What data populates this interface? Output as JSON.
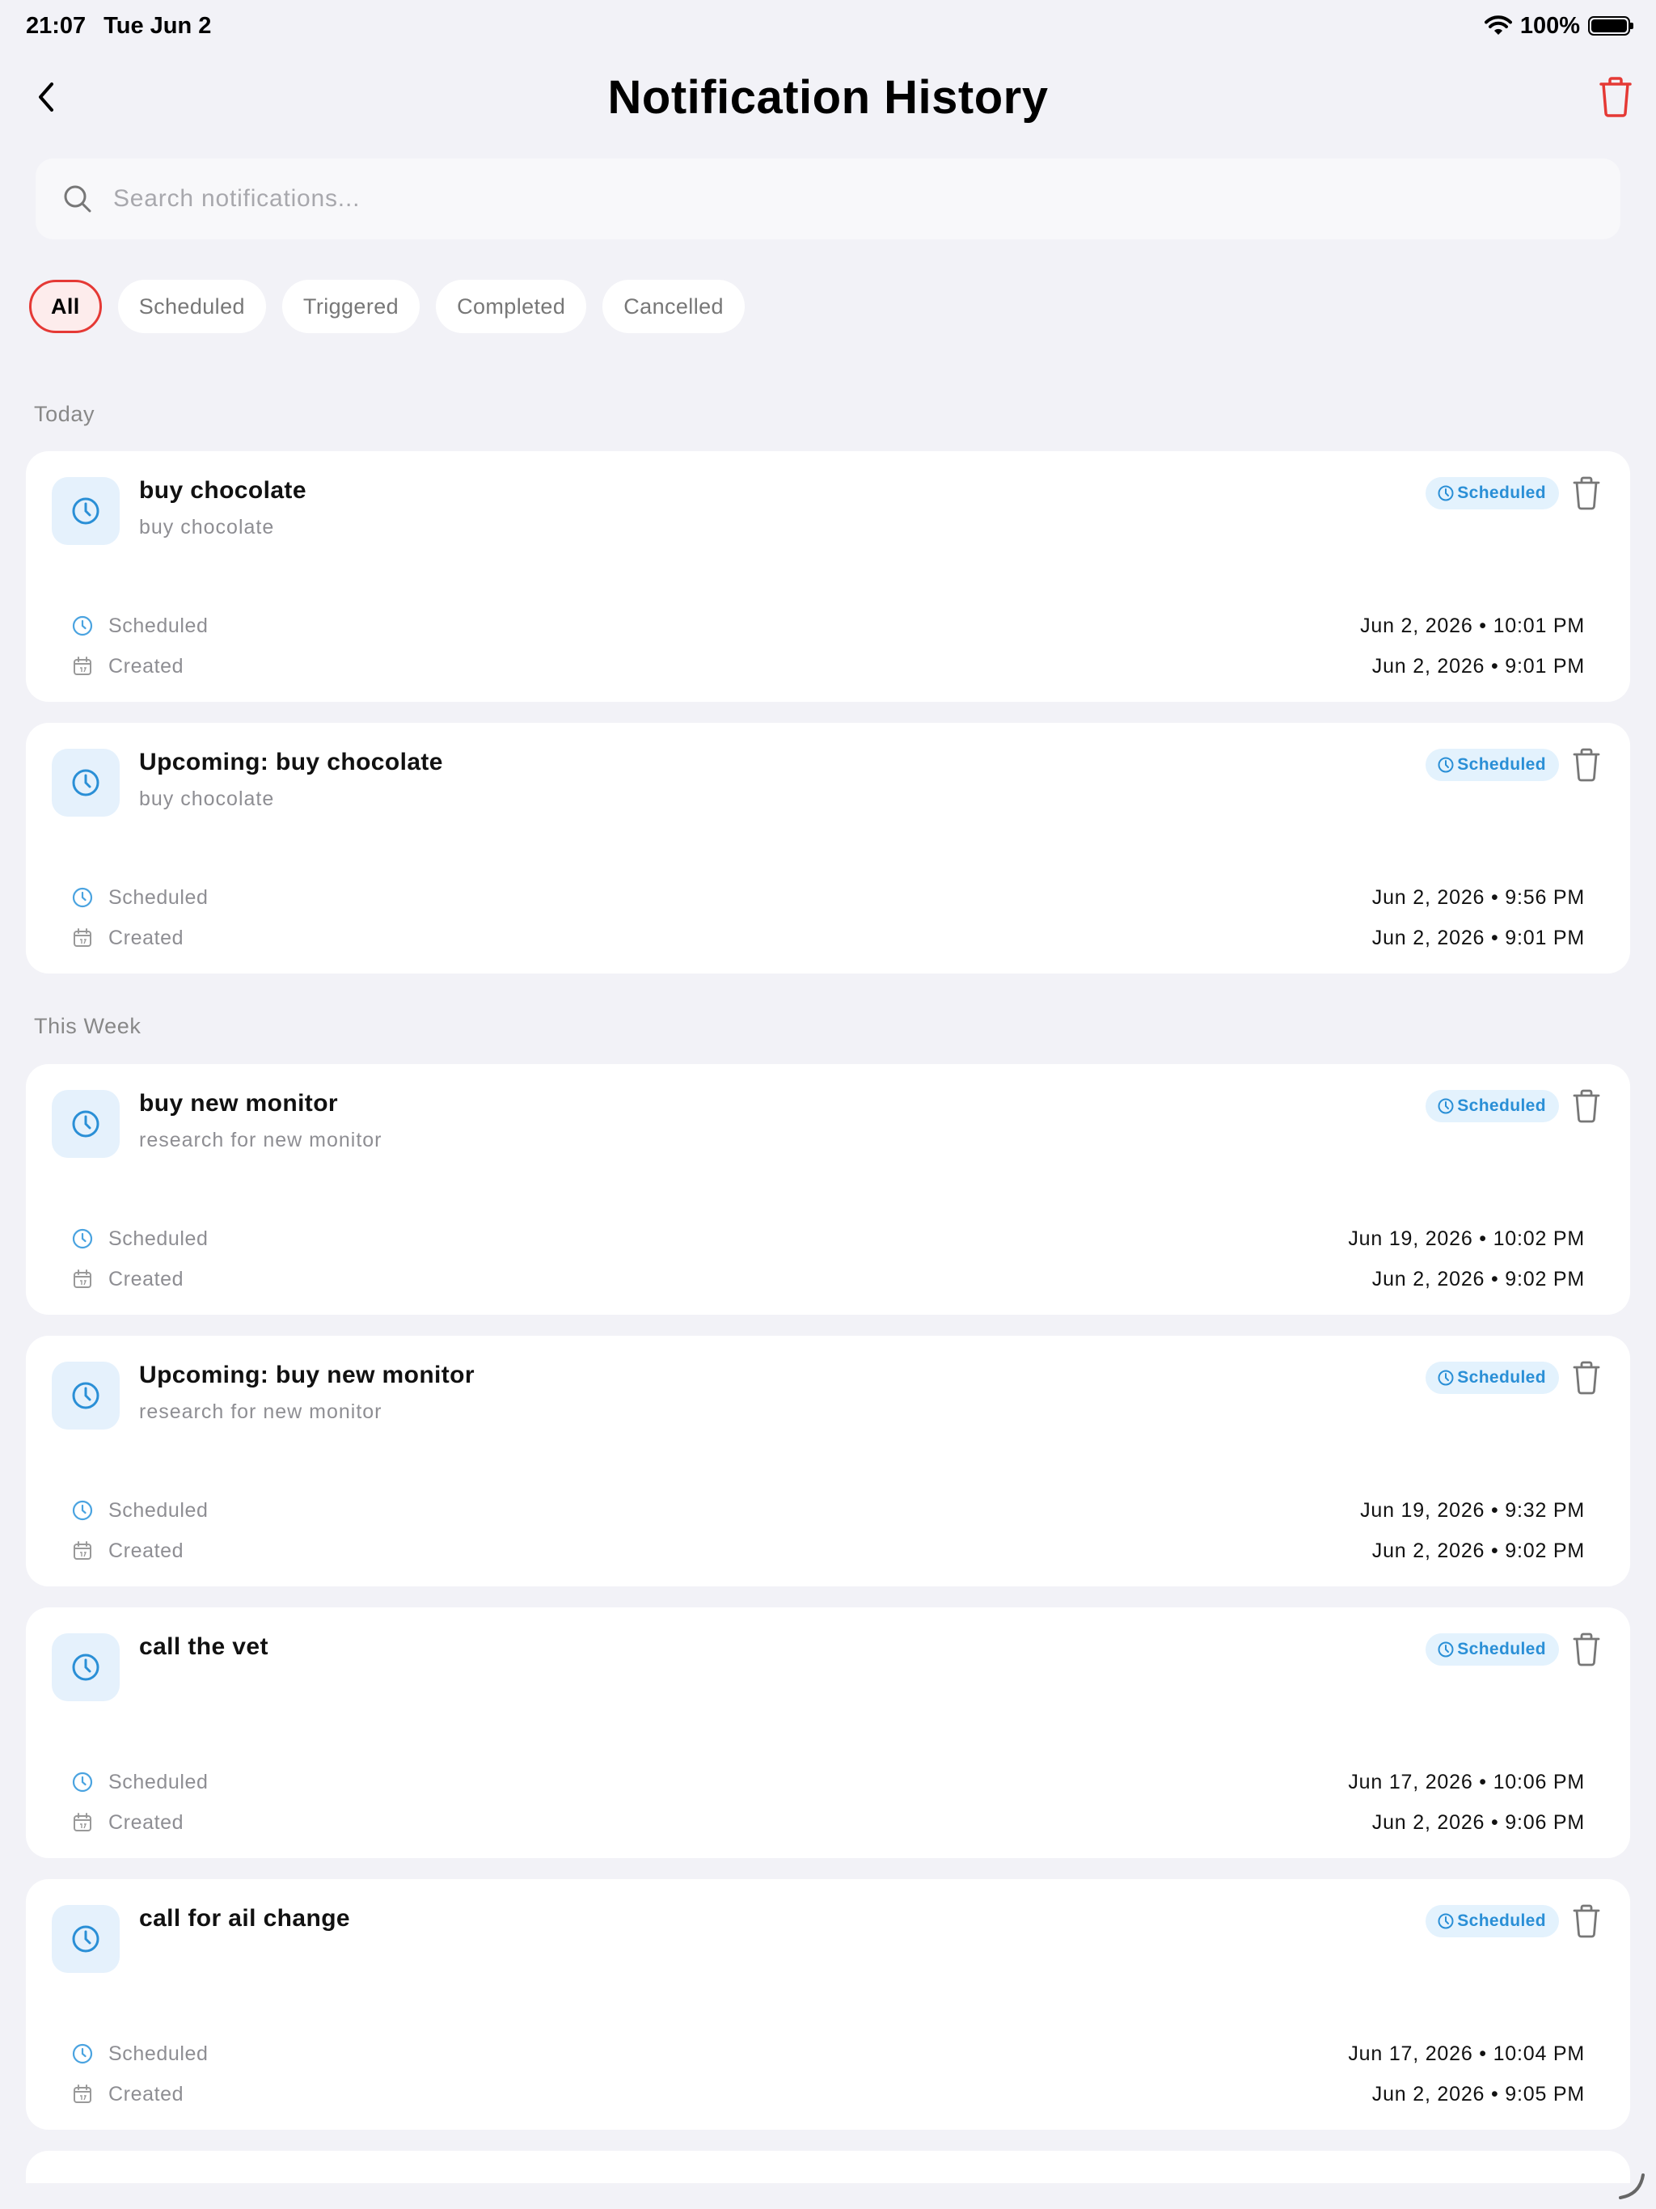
{
  "status_bar": {
    "time": "21:07",
    "date": "Tue Jun 2",
    "battery": "100%"
  },
  "header": {
    "title": "Notification History"
  },
  "search": {
    "placeholder": "Search notifications..."
  },
  "filters": [
    {
      "label": "All",
      "active": true
    },
    {
      "label": "Scheduled",
      "active": false
    },
    {
      "label": "Triggered",
      "active": false
    },
    {
      "label": "Completed",
      "active": false
    },
    {
      "label": "Cancelled",
      "active": false
    }
  ],
  "sections": [
    {
      "label": "Today"
    },
    {
      "label": "This Week"
    }
  ],
  "meta_labels": {
    "scheduled": "Scheduled",
    "created": "Created"
  },
  "colors": {
    "accent_red": "#e53935",
    "badge_blue": "#2a8fd6",
    "icon_bg": "#e5f1fc"
  },
  "notifications": [
    {
      "title": "buy chocolate",
      "subtitle": "buy chocolate",
      "status": "Scheduled",
      "scheduled": "Jun 2, 2026 • 10:01 PM",
      "created": "Jun 2, 2026 • 9:01 PM"
    },
    {
      "title": "Upcoming: buy chocolate",
      "subtitle": "buy chocolate",
      "status": "Scheduled",
      "scheduled": "Jun 2, 2026 • 9:56 PM",
      "created": "Jun 2, 2026 • 9:01 PM"
    },
    {
      "title": "buy new monitor",
      "subtitle": "research for new monitor",
      "status": "Scheduled",
      "scheduled": "Jun 19, 2026 • 10:02 PM",
      "created": "Jun 2, 2026 • 9:02 PM"
    },
    {
      "title": "Upcoming: buy new monitor",
      "subtitle": "research for new monitor",
      "status": "Scheduled",
      "scheduled": "Jun 19, 2026 • 9:32 PM",
      "created": "Jun 2, 2026 • 9:02 PM"
    },
    {
      "title": "call the vet",
      "subtitle": "",
      "status": "Scheduled",
      "scheduled": "Jun 17, 2026 • 10:06 PM",
      "created": "Jun 2, 2026 • 9:06 PM"
    },
    {
      "title": "call for ail change",
      "subtitle": "",
      "status": "Scheduled",
      "scheduled": "Jun 17, 2026 • 10:04 PM",
      "created": "Jun 2, 2026 • 9:05 PM"
    }
  ]
}
